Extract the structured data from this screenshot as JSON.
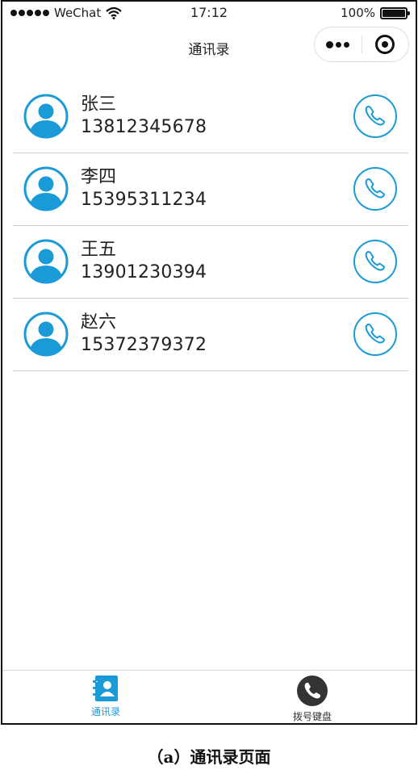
{
  "status_bar": {
    "carrier": "WeChat",
    "time": "17:12",
    "battery": "100%",
    "battery_level": 1.0
  },
  "nav": {
    "title": "通讯录"
  },
  "contacts": [
    {
      "name": "张三",
      "phone": "13812345678"
    },
    {
      "name": "李四",
      "phone": "15395311234"
    },
    {
      "name": "王五",
      "phone": "13901230394"
    },
    {
      "name": "赵六",
      "phone": "15372379372"
    }
  ],
  "tab_bar": {
    "tabs": [
      {
        "label": "通讯录",
        "icon": "contacts-icon",
        "active": true
      },
      {
        "label": "拨号键盘",
        "icon": "phone-icon",
        "active": false
      }
    ]
  },
  "caption": "（a）通讯录页面",
  "colors": {
    "accent": "#1a9bd7",
    "divider": "#cfcfcf"
  }
}
